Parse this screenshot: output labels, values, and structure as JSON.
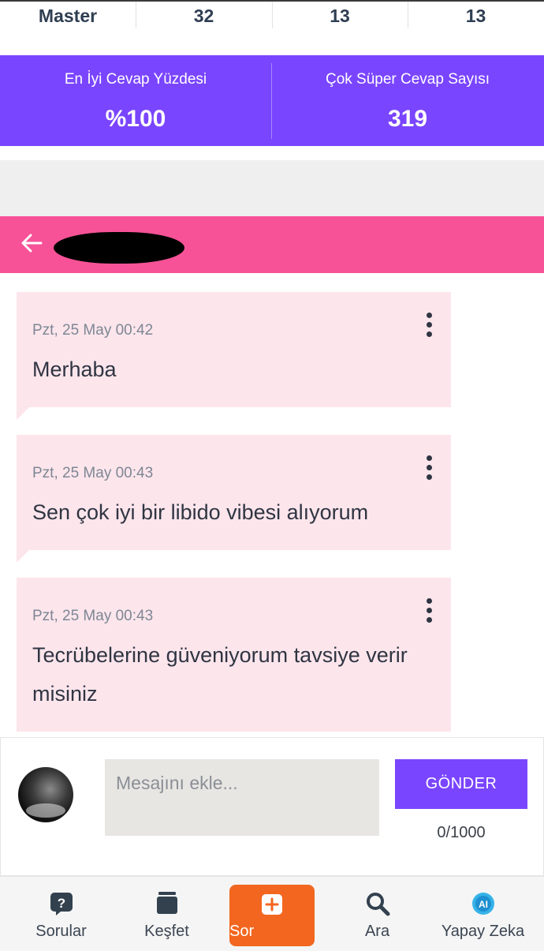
{
  "stats": {
    "level": "Master",
    "values": [
      "32",
      "13",
      "13"
    ]
  },
  "banner": {
    "best_answer_label": "En İyi Cevap Yüzdesi",
    "best_answer_value": "%100",
    "super_answer_label": "Çok Süper Cevap Sayısı",
    "super_answer_value": "319"
  },
  "chat": {
    "messages": [
      {
        "date": "Pzt, 25 May 00:42",
        "text": "Merhaba"
      },
      {
        "date": "Pzt, 25 May 00:43",
        "text": "Sen çok iyi bir libido vibesi alıyorum"
      },
      {
        "date": "Pzt, 25 May 00:43",
        "text": "Tecrübelerine güveniyorum tavsiye verir misiniz"
      }
    ]
  },
  "composer": {
    "placeholder": "Mesajını ekle...",
    "send_label": "GÖNDER",
    "char_count": "0/1000"
  },
  "nav": {
    "questions": "Sorular",
    "discover": "Keşfet",
    "ask": "Sor",
    "search": "Ara",
    "ai": "Yapay Zeka"
  },
  "colors": {
    "purple": "#7a45ff",
    "pink_header": "#f75297",
    "bubble": "#fde5ec",
    "orange": "#f2661f"
  }
}
